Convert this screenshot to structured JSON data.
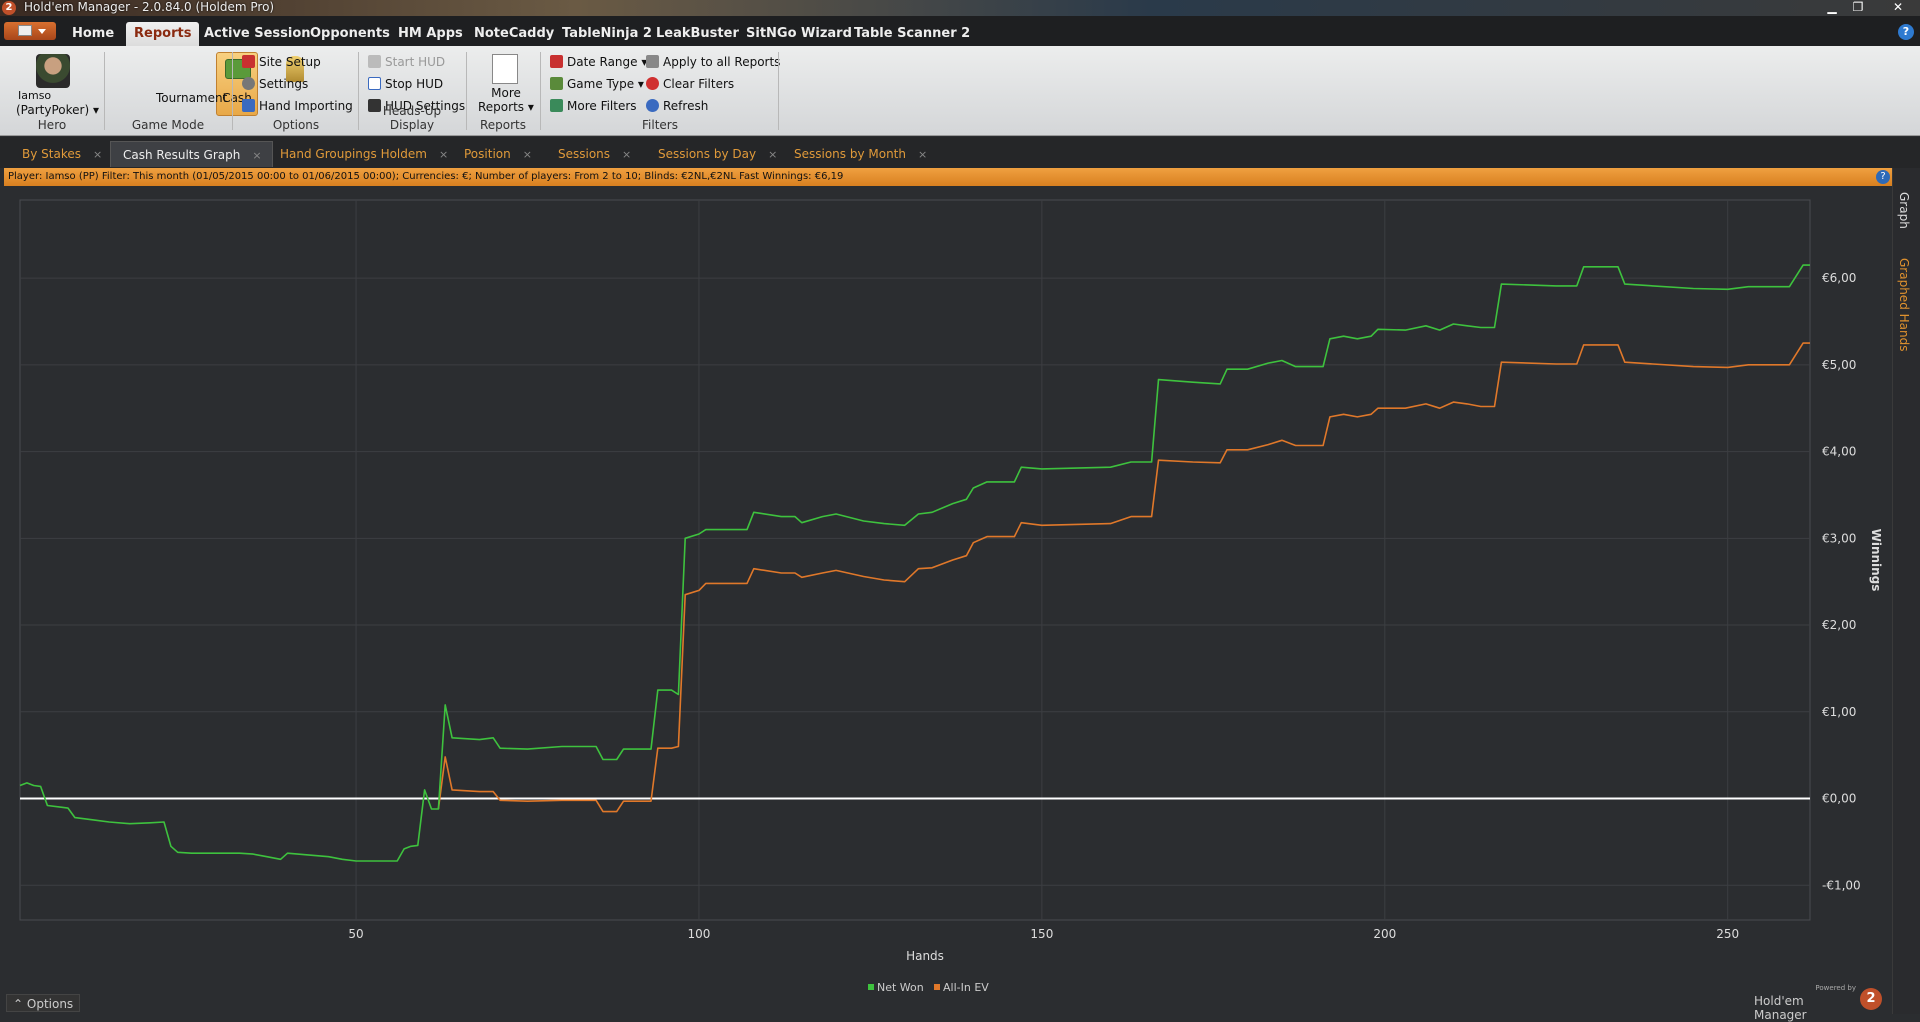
{
  "window": {
    "title": "Hold'em Manager - 2.0.84.0 (Holdem Pro)",
    "logo": "2"
  },
  "menu": {
    "tabs": [
      "Home",
      "Reports",
      "Active Session",
      "Opponents",
      "HM Apps",
      "NoteCaddy",
      "TableNinja 2",
      "LeakBuster",
      "SitNGo Wizard",
      "Table Scanner 2"
    ],
    "active": "Reports"
  },
  "ribbon": {
    "hero": {
      "name": "Iamso",
      "site": "(PartyPoker) ▾",
      "label": "Hero"
    },
    "game_mode": {
      "cash": "Cash",
      "tournament": "Tournament",
      "label": "Game Mode"
    },
    "options": {
      "site_setup": "Site Setup",
      "settings": "Settings",
      "hand_importing": "Hand Importing",
      "label": "Options"
    },
    "hud": {
      "start": "Start HUD",
      "stop": "Stop HUD",
      "settings": "HUD Settings",
      "label": "Heads-Up Display"
    },
    "reports": {
      "more_line1": "More",
      "more_line2": "Reports ▾",
      "label": "Reports"
    },
    "filters": {
      "date_range": "Date Range ▾",
      "game_type": "Game Type ▾",
      "more_filters": "More Filters",
      "apply_all": "Apply to all Reports",
      "clear": "Clear Filters",
      "refresh": "Refresh",
      "label": "Filters"
    }
  },
  "doc_tabs": [
    "By Stakes",
    "Cash Results Graph",
    "Hand Groupings Holdem",
    "Position",
    "Sessions",
    "Sessions by Day",
    "Sessions by Month"
  ],
  "doc_tab_close": "×",
  "filter_bar": "Player: Iamso (PP)  Filter:  This month (01/05/2015 00:00 to 01/06/2015 00:00); Currencies: €; Number of players: From 2 to 10; Blinds: €2NL,€2NL Fast  Winnings:  €6,19",
  "side_tabs": {
    "graph": "Graph",
    "graphed_hands": "Graphed Hands"
  },
  "options_button": "Options",
  "branding": {
    "powered": "Powered by",
    "name": "Hold'em Manager"
  },
  "colors": {
    "net_won": "#3ec23e",
    "all_in_ev": "#e0782a",
    "zero_line": "#ffffff",
    "accent": "#e8922e"
  },
  "chart_data": {
    "type": "line",
    "xlabel": "Hands",
    "ylabel": "Winnings",
    "xlim": [
      1,
      262
    ],
    "ylim": [
      -1.4,
      6.9
    ],
    "x_ticks": [
      50,
      100,
      150,
      200,
      250
    ],
    "y_ticks": [
      -1,
      0,
      1,
      2,
      3,
      4,
      5,
      6
    ],
    "y_tick_labels": [
      "-€1,00",
      "€0,00",
      "€1,00",
      "€2,00",
      "€3,00",
      "€4,00",
      "€5,00",
      "€6,00"
    ],
    "grid": true,
    "legend_position": "bottom-center",
    "series": [
      {
        "name": "Net Won",
        "points": [
          [
            1,
            0.15
          ],
          [
            2,
            0.18
          ],
          [
            3,
            0.15
          ],
          [
            4,
            0.14
          ],
          [
            5,
            -0.08
          ],
          [
            7,
            -0.1
          ],
          [
            8,
            -0.11
          ],
          [
            9,
            -0.22
          ],
          [
            12,
            -0.25
          ],
          [
            14,
            -0.27
          ],
          [
            17,
            -0.29
          ],
          [
            20,
            -0.28
          ],
          [
            22,
            -0.27
          ],
          [
            23,
            -0.55
          ],
          [
            24,
            -0.62
          ],
          [
            26,
            -0.63
          ],
          [
            33,
            -0.63
          ],
          [
            35,
            -0.64
          ],
          [
            37,
            -0.67
          ],
          [
            39,
            -0.7
          ],
          [
            40,
            -0.63
          ],
          [
            43,
            -0.65
          ],
          [
            46,
            -0.67
          ],
          [
            48,
            -0.7
          ],
          [
            50,
            -0.72
          ],
          [
            55,
            -0.72
          ],
          [
            56,
            -0.72
          ],
          [
            57,
            -0.58
          ],
          [
            58,
            -0.55
          ],
          [
            59,
            -0.54
          ],
          [
            60,
            0.1
          ],
          [
            61,
            -0.12
          ],
          [
            62,
            -0.12
          ],
          [
            63,
            1.08
          ],
          [
            64,
            0.7
          ],
          [
            68,
            0.68
          ],
          [
            70,
            0.7
          ],
          [
            71,
            0.58
          ],
          [
            75,
            0.57
          ],
          [
            80,
            0.6
          ],
          [
            85,
            0.6
          ],
          [
            86,
            0.45
          ],
          [
            88,
            0.45
          ],
          [
            89,
            0.57
          ],
          [
            93,
            0.57
          ],
          [
            94,
            1.25
          ],
          [
            96,
            1.25
          ],
          [
            97,
            1.2
          ],
          [
            98,
            3.0
          ],
          [
            100,
            3.05
          ],
          [
            101,
            3.1
          ],
          [
            107,
            3.1
          ],
          [
            108,
            3.3
          ],
          [
            112,
            3.25
          ],
          [
            114,
            3.25
          ],
          [
            115,
            3.18
          ],
          [
            118,
            3.25
          ],
          [
            120,
            3.28
          ],
          [
            124,
            3.2
          ],
          [
            127,
            3.17
          ],
          [
            130,
            3.15
          ],
          [
            132,
            3.28
          ],
          [
            134,
            3.3
          ],
          [
            137,
            3.4
          ],
          [
            139,
            3.45
          ],
          [
            140,
            3.58
          ],
          [
            142,
            3.65
          ],
          [
            146,
            3.65
          ],
          [
            147,
            3.82
          ],
          [
            150,
            3.8
          ],
          [
            160,
            3.82
          ],
          [
            163,
            3.88
          ],
          [
            166,
            3.88
          ],
          [
            167,
            4.83
          ],
          [
            172,
            4.8
          ],
          [
            176,
            4.78
          ],
          [
            177,
            4.95
          ],
          [
            180,
            4.95
          ],
          [
            183,
            5.02
          ],
          [
            185,
            5.05
          ],
          [
            187,
            4.98
          ],
          [
            191,
            4.98
          ],
          [
            192,
            5.3
          ],
          [
            194,
            5.33
          ],
          [
            196,
            5.3
          ],
          [
            198,
            5.33
          ],
          [
            199,
            5.41
          ],
          [
            203,
            5.4
          ],
          [
            206,
            5.45
          ],
          [
            208,
            5.4
          ],
          [
            210,
            5.47
          ],
          [
            212,
            5.45
          ],
          [
            214,
            5.43
          ],
          [
            216,
            5.43
          ],
          [
            217,
            5.93
          ],
          [
            225,
            5.91
          ],
          [
            228,
            5.91
          ],
          [
            229,
            6.13
          ],
          [
            234,
            6.13
          ],
          [
            235,
            5.93
          ],
          [
            245,
            5.88
          ],
          [
            250,
            5.87
          ],
          [
            253,
            5.9
          ],
          [
            256,
            5.9
          ],
          [
            259,
            5.9
          ],
          [
            261,
            6.15
          ],
          [
            262,
            6.15
          ]
        ]
      },
      {
        "name": "All-In EV",
        "points": [
          [
            62,
            -0.12
          ],
          [
            63,
            0.48
          ],
          [
            64,
            0.1
          ],
          [
            68,
            0.08
          ],
          [
            70,
            0.08
          ],
          [
            71,
            -0.02
          ],
          [
            75,
            -0.03
          ],
          [
            80,
            -0.02
          ],
          [
            85,
            -0.02
          ],
          [
            86,
            -0.15
          ],
          [
            88,
            -0.15
          ],
          [
            89,
            -0.03
          ],
          [
            93,
            -0.03
          ],
          [
            94,
            0.58
          ],
          [
            96,
            0.58
          ],
          [
            97,
            0.6
          ],
          [
            98,
            2.35
          ],
          [
            100,
            2.4
          ],
          [
            101,
            2.48
          ],
          [
            107,
            2.48
          ],
          [
            108,
            2.65
          ],
          [
            112,
            2.6
          ],
          [
            114,
            2.6
          ],
          [
            115,
            2.55
          ],
          [
            118,
            2.6
          ],
          [
            120,
            2.63
          ],
          [
            124,
            2.56
          ],
          [
            127,
            2.52
          ],
          [
            130,
            2.5
          ],
          [
            132,
            2.65
          ],
          [
            134,
            2.66
          ],
          [
            137,
            2.75
          ],
          [
            139,
            2.8
          ],
          [
            140,
            2.95
          ],
          [
            142,
            3.02
          ],
          [
            146,
            3.02
          ],
          [
            147,
            3.18
          ],
          [
            150,
            3.15
          ],
          [
            160,
            3.17
          ],
          [
            163,
            3.25
          ],
          [
            166,
            3.25
          ],
          [
            167,
            3.9
          ],
          [
            172,
            3.88
          ],
          [
            176,
            3.87
          ],
          [
            177,
            4.02
          ],
          [
            180,
            4.02
          ],
          [
            183,
            4.08
          ],
          [
            185,
            4.13
          ],
          [
            187,
            4.07
          ],
          [
            191,
            4.07
          ],
          [
            192,
            4.4
          ],
          [
            194,
            4.43
          ],
          [
            196,
            4.4
          ],
          [
            198,
            4.43
          ],
          [
            199,
            4.5
          ],
          [
            203,
            4.5
          ],
          [
            206,
            4.55
          ],
          [
            208,
            4.5
          ],
          [
            210,
            4.57
          ],
          [
            212,
            4.55
          ],
          [
            214,
            4.52
          ],
          [
            216,
            4.52
          ],
          [
            217,
            5.03
          ],
          [
            225,
            5.01
          ],
          [
            228,
            5.01
          ],
          [
            229,
            5.23
          ],
          [
            234,
            5.23
          ],
          [
            235,
            5.03
          ],
          [
            245,
            4.98
          ],
          [
            250,
            4.97
          ],
          [
            253,
            5.0
          ],
          [
            256,
            5.0
          ],
          [
            259,
            5.0
          ],
          [
            261,
            5.25
          ],
          [
            262,
            5.25
          ]
        ]
      }
    ]
  }
}
